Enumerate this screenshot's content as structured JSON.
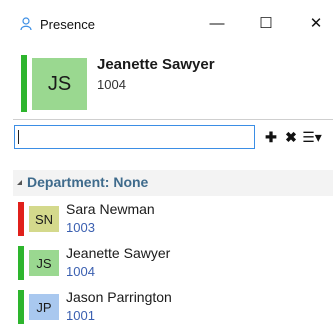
{
  "window": {
    "title": "Presence",
    "minimize_glyph": "—",
    "maximize_glyph": "☐",
    "close_glyph": "✕"
  },
  "me": {
    "name": "Jeanette Sawyer",
    "extension": "1004",
    "initials": "JS",
    "status_color": "#2db52d",
    "avatar_color": "#9ad890"
  },
  "search": {
    "value": "",
    "placeholder": ""
  },
  "toolbar": {
    "add_glyph": "✚",
    "remove_glyph": "✖",
    "view_glyph": "☰▾"
  },
  "group": {
    "label": "Department: None"
  },
  "contacts": [
    {
      "name": "Sara Newman",
      "extension": "1003",
      "initials": "SN",
      "status_color": "#e0201b",
      "avatar_color": "#d4d98c"
    },
    {
      "name": "Jeanette Sawyer",
      "extension": "1004",
      "initials": "JS",
      "status_color": "#2db52d",
      "avatar_color": "#9ad890"
    },
    {
      "name": "Jason Parrington",
      "extension": "1001",
      "initials": "JP",
      "status_color": "#2db52d",
      "avatar_color": "#a9c8ef"
    }
  ]
}
